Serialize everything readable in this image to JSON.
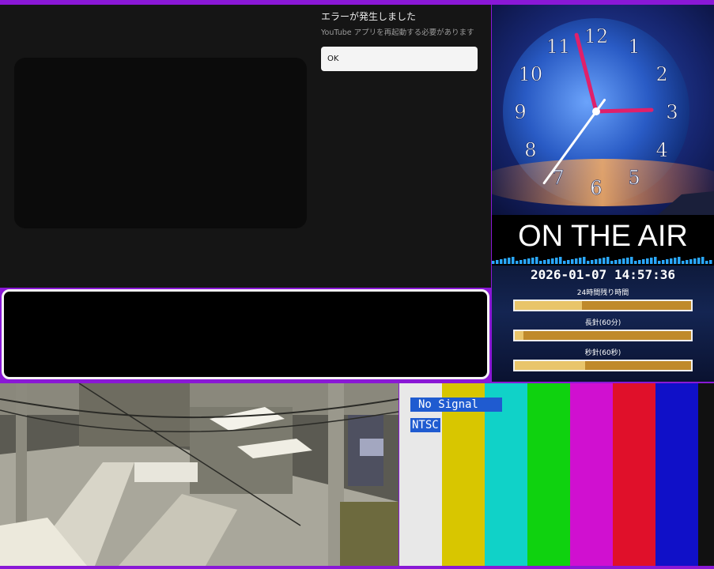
{
  "youtube_error": {
    "title": "エラーが発生しました",
    "message": "YouTube アプリを再起動する必要があります",
    "ok_label": "OK"
  },
  "clock": {
    "numerals": [
      "12",
      "1",
      "2",
      "3",
      "4",
      "5",
      "6",
      "7",
      "8",
      "9",
      "10",
      "11"
    ],
    "time": {
      "hour": 14,
      "minute": 57,
      "second": 36
    }
  },
  "on_air": {
    "title": "ON THE AIR",
    "datetime": "2026-01-07 14:57:36",
    "bars": [
      {
        "label": "24時間残り時間",
        "fraction": 0.38
      },
      {
        "label": "長針(60分)",
        "fraction": 0.05
      },
      {
        "label": "秒針(60秒)",
        "fraction": 0.4
      }
    ]
  },
  "test_pattern": {
    "no_signal": "No Signal",
    "standard": "NTSC",
    "colors": [
      "#e8e8e8",
      "#d8c600",
      "#10d2c8",
      "#0fd20f",
      "#d010d0",
      "#e0102a",
      "#1010c8"
    ]
  },
  "colors": {
    "frame": "#8a18d6",
    "dialog_bg": "#151515",
    "bar_fill": "#e9c56a"
  }
}
